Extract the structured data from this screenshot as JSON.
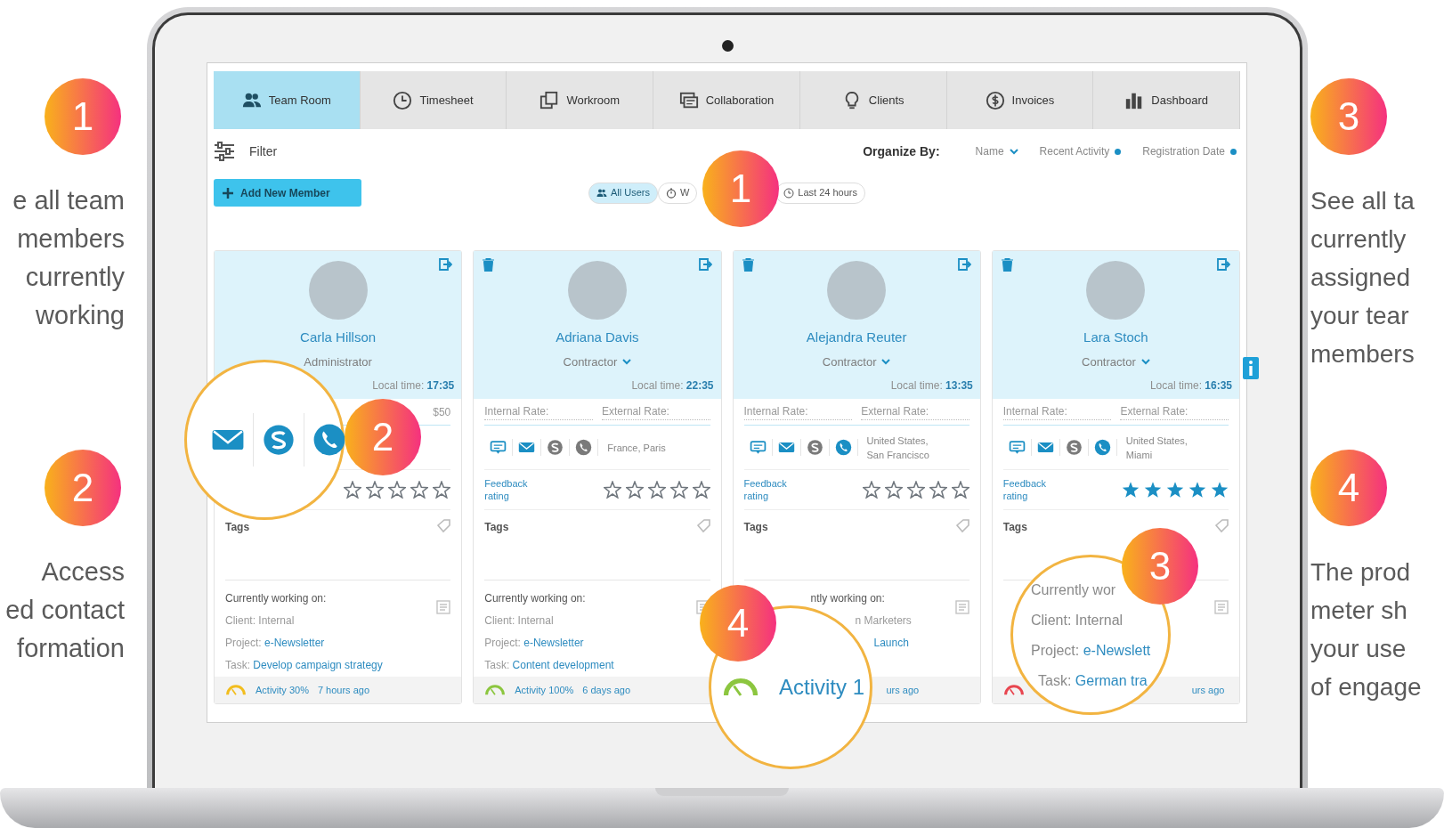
{
  "left_notes": [
    {
      "number": "1",
      "text": "e all team\nmembers\ncurrently\nworking"
    },
    {
      "number": "2",
      "text": "Access\ned contact\nformation"
    }
  ],
  "right_notes": [
    {
      "number": "3",
      "text": "See all ta\ncurrently\nassigned\nyour tear\nmembers"
    },
    {
      "number": "4",
      "text": "The prod\nmeter sh\nyour use\nof engage"
    }
  ],
  "tabs": [
    {
      "label": "Team Room",
      "selected": true
    },
    {
      "label": "Timesheet",
      "selected": false
    },
    {
      "label": "Workroom",
      "selected": false
    },
    {
      "label": "Collaboration",
      "selected": false
    },
    {
      "label": "Clients",
      "selected": false
    },
    {
      "label": "Invoices",
      "selected": false
    },
    {
      "label": "Dashboard",
      "selected": false
    }
  ],
  "filter": {
    "label": "Filter"
  },
  "organize": {
    "label": "Organize By:",
    "options": [
      {
        "label": "Name",
        "kind": "chevron"
      },
      {
        "label": "Recent Activity",
        "kind": "dot"
      },
      {
        "label": "Registration Date",
        "kind": "dot"
      }
    ]
  },
  "add_button": {
    "label": "Add New Member"
  },
  "user_filters": [
    {
      "label": "All Users",
      "selected": true
    },
    {
      "label": "W",
      "selected": false
    },
    {
      "label": "Last 24 hours",
      "selected": false
    }
  ],
  "cards": [
    {
      "name": "Carla Hillson",
      "role": "Administrator",
      "role_menu": false,
      "deletable": false,
      "local_time_label": "Local time:",
      "local_time": "17:35",
      "rates": {
        "external_value": "$50"
      },
      "stars": 0,
      "tags_label": "Tags",
      "work": {
        "kind": "full",
        "heading": "Currently working on:",
        "client": "Client: Internal",
        "project_label": "Project:",
        "project": "e-Newsletter",
        "task_label": "Task:",
        "task": "Develop campaign strategy"
      },
      "activity": {
        "kind": "full",
        "color": "#f2bd1d",
        "text": "Activity 30%",
        "ago": "7 hours ago"
      }
    },
    {
      "name": "Adriana Davis",
      "role": "Contractor",
      "role_menu": true,
      "deletable": true,
      "local_time_label": "Local time:",
      "local_time": "22:35",
      "rates": {
        "internal_label": "Internal Rate:",
        "external_label": "External Rate:"
      },
      "contacts": [
        {
          "kind": "chat",
          "active": true
        },
        {
          "kind": "mail",
          "active": true
        },
        {
          "kind": "s-logo",
          "active": false
        },
        {
          "kind": "phone",
          "active": false
        }
      ],
      "location": "France, Paris",
      "feedback_label": "Feedback rating",
      "stars": 0,
      "tags_label": "Tags",
      "work": {
        "kind": "full",
        "heading": "Currently working on:",
        "client": "Client: Internal",
        "project_label": "Project:",
        "project": "e-Newsletter",
        "task_label": "Task:",
        "task": "Content development"
      },
      "activity": {
        "kind": "full",
        "color": "#8cc63f",
        "text": "Activity 100%",
        "ago": "6 days ago"
      }
    },
    {
      "name": "Alejandra Reuter",
      "role": "Contractor",
      "role_menu": true,
      "deletable": true,
      "local_time_label": "Local time:",
      "local_time": "13:35",
      "rates": {
        "internal_label": "Internal Rate:",
        "external_label": "External Rate:"
      },
      "contacts": [
        {
          "kind": "chat",
          "active": true
        },
        {
          "kind": "mail",
          "active": true
        },
        {
          "kind": "s-logo",
          "active": false
        },
        {
          "kind": "phone",
          "active": true
        }
      ],
      "location": "United States,\nSan Francisco",
      "feedback_label": "Feedback rating",
      "stars": 0,
      "tags_label": "Tags",
      "work": {
        "kind": "partial",
        "heading": "ntly working on:",
        "client": "n Marketers",
        "project": "Launch"
      },
      "activity": {
        "kind": "partial",
        "ago": "urs ago"
      }
    },
    {
      "name": "Lara Stoch",
      "role": "Contractor",
      "role_menu": true,
      "deletable": true,
      "local_time_label": "Local time:",
      "local_time": "16:35",
      "rates": {
        "internal_label": "Internal Rate:",
        "external_label": "External Rate:"
      },
      "contacts": [
        {
          "kind": "chat",
          "active": true
        },
        {
          "kind": "mail",
          "active": true
        },
        {
          "kind": "s-logo",
          "active": false
        },
        {
          "kind": "phone",
          "active": true
        }
      ],
      "location": "United States,\nMiami",
      "feedback_label": "Feedback rating",
      "stars": 5,
      "tags_label": "Tags",
      "work": {
        "kind": "partial"
      },
      "activity": {
        "kind": "partial",
        "color": "#e8454f",
        "ago": "urs ago"
      }
    }
  ],
  "screen_badges": [
    {
      "number": "1"
    },
    {
      "number": "2"
    },
    {
      "number": "3"
    },
    {
      "number": "4"
    }
  ],
  "lenses": [
    {
      "kind": "contacts",
      "contacts": [
        {
          "kind": "mail",
          "active": true
        },
        {
          "kind": "s-logo",
          "active": true
        },
        {
          "kind": "phone",
          "active": true
        }
      ]
    },
    {
      "kind": "work",
      "lines": [
        {
          "label": "Currently wor"
        },
        {
          "label": "Client: Internal"
        },
        {
          "label": "Project:",
          "value": "e-Newslett"
        },
        {
          "label": "Task:",
          "value": "German tra"
        }
      ]
    },
    {
      "kind": "activity",
      "color": "#8cc63f",
      "text": "Activity 1"
    }
  ]
}
